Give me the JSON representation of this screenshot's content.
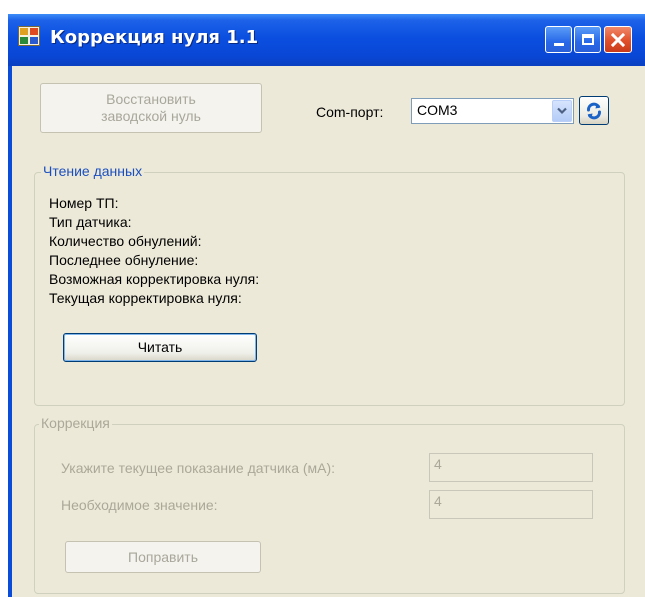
{
  "window": {
    "title": "Коррекция нуля 1.1"
  },
  "toolbar": {
    "restore_button_label": "Восстановить\nзаводской нуль",
    "com_port_label": "Com-порт:",
    "com_port_value": "COM3"
  },
  "read_group": {
    "title": "Чтение данных",
    "fields": [
      "Номер ТП:",
      "Тип датчика:",
      "Количество обнулений:",
      "Последнее обнуление:",
      "Возможная корректировка нуля:",
      "Текущая корректировка нуля:"
    ],
    "read_button_label": "Читать"
  },
  "correction_group": {
    "title": "Коррекция",
    "current_label": "Укажите текущее показание датчика (мА):",
    "current_value": "4",
    "required_label": "Необходимое значение:",
    "required_value": "4",
    "fix_button_label": "Поправить"
  },
  "colors": {
    "titlebar": "#0a4bd8",
    "client_bg": "#ece9d8",
    "group_title_active": "#1b4fbf",
    "disabled_text": "#aca899"
  },
  "icons": [
    "app-icon",
    "minimize-icon",
    "maximize-icon",
    "close-icon",
    "chevron-down-icon",
    "refresh-icon"
  ]
}
